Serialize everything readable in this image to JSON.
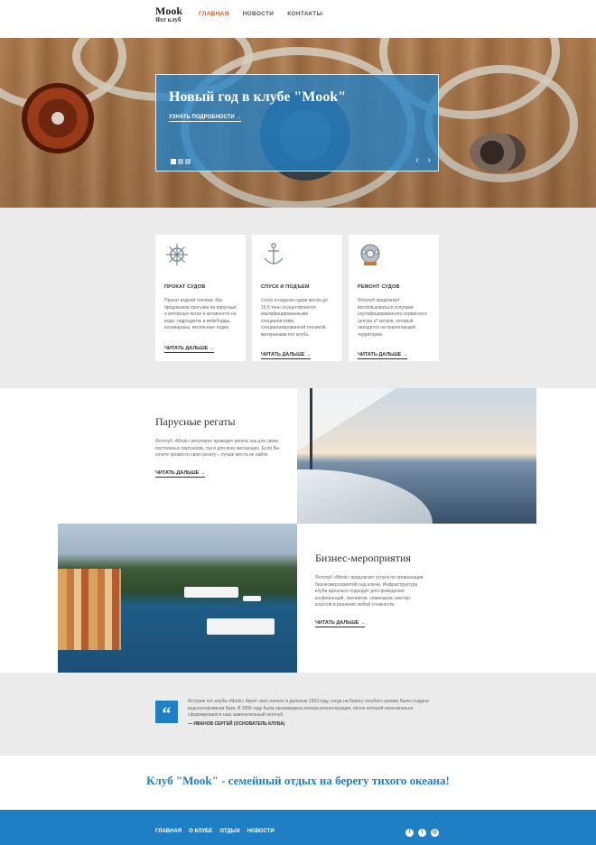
{
  "header": {
    "logo_main": "Mook",
    "logo_sub": "Яхт клуб",
    "nav": [
      "ГЛАВНАЯ",
      "НОВОСТИ",
      "КОНТАКТЫ"
    ],
    "active_index": 0
  },
  "hero": {
    "title": "Новый год в клубе \"Mook\"",
    "link": "УЗНАТЬ ПОДРОБНОСТИ →",
    "prev_icon": "chevron-left-icon",
    "next_icon": "chevron-right-icon"
  },
  "services": [
    {
      "icon": "ship-wheel-icon",
      "title": "ПРОКАТ СУДОВ",
      "text": "Прокат водной техники. Мы предлагаем прогулки на парусных и моторных яхтах и активности на воде: гидроциклы и вейкборды, катамараны, весельные лодки.",
      "link": "ЧИТАТЬ ДАЛЬШЕ →"
    },
    {
      "icon": "anchor-icon",
      "title": "СПУСК И ПОДЪЕМ",
      "text": "Спуск и подъем судов весом до 16,5 тонн осуществляется квалифицированными специалистами, специализированной техникой, материнами яхт клуба.",
      "link": "ЧИТАТЬ ДАЛЬШЕ →"
    },
    {
      "icon": "diving-helmet-icon",
      "title": "РЕМОНТ СУДОВ",
      "text": "Яхтклуб предлагает воспользоваться услугами сертифицированного сервисного центра к7 ветров, который находится на прилегающей территории.",
      "link": "ЧИТАТЬ ДАЛЬШЕ →"
    }
  ],
  "regatta": {
    "title": "Парусные регаты",
    "text": "Яхтклуб «Mook» регулярно проводит регаты как для своих постоянных партнеров, так и для всех желающих. Если Вы хотите провести свою регату – лучше места не найти.",
    "link": "ЧИТАТЬ ДАЛЬШЕ →"
  },
  "business": {
    "title": "Бизнес-мероприятия",
    "text": "Яхтклуб «Mook» предлагает услуги по организации бизнесмероприятий под ключи. Инфраструктура клуба идеально подходит для проведения конференций, тренингов, семинаров, мастер-классов и решения любой сложности.",
    "link": "ЧИТАТЬ ДАЛЬШЕ →"
  },
  "quote": {
    "mark": "“",
    "text": "История яхт-клуба «Mook» берет свое начало в далеком 1993 году, когда на берегу голубого залива была создана водноспортивная база. В 2006 году была произведена полная реконструкция, после которой окончательно сформировался наш замечательный яхтклуб.",
    "author": "— ИВАНОВ СЕРГЕЙ (ОСНОВАТЕЛЬ КЛУБА)"
  },
  "slogan": "Клуб \"Mook\" - семейный отдых на берегу тихого океана!",
  "footer": {
    "nav": [
      "ГЛАВНАЯ",
      "О КЛУБЕ",
      "ОТДЫХ",
      "НОВОСТИ"
    ],
    "social": [
      {
        "icon": "facebook-icon",
        "glyph": "f"
      },
      {
        "icon": "twitter-icon",
        "glyph": "t"
      },
      {
        "icon": "instagram-icon",
        "glyph": "◎"
      }
    ]
  },
  "colors": {
    "accent": "#1f7fc4",
    "active_nav": "#e25a1c"
  }
}
